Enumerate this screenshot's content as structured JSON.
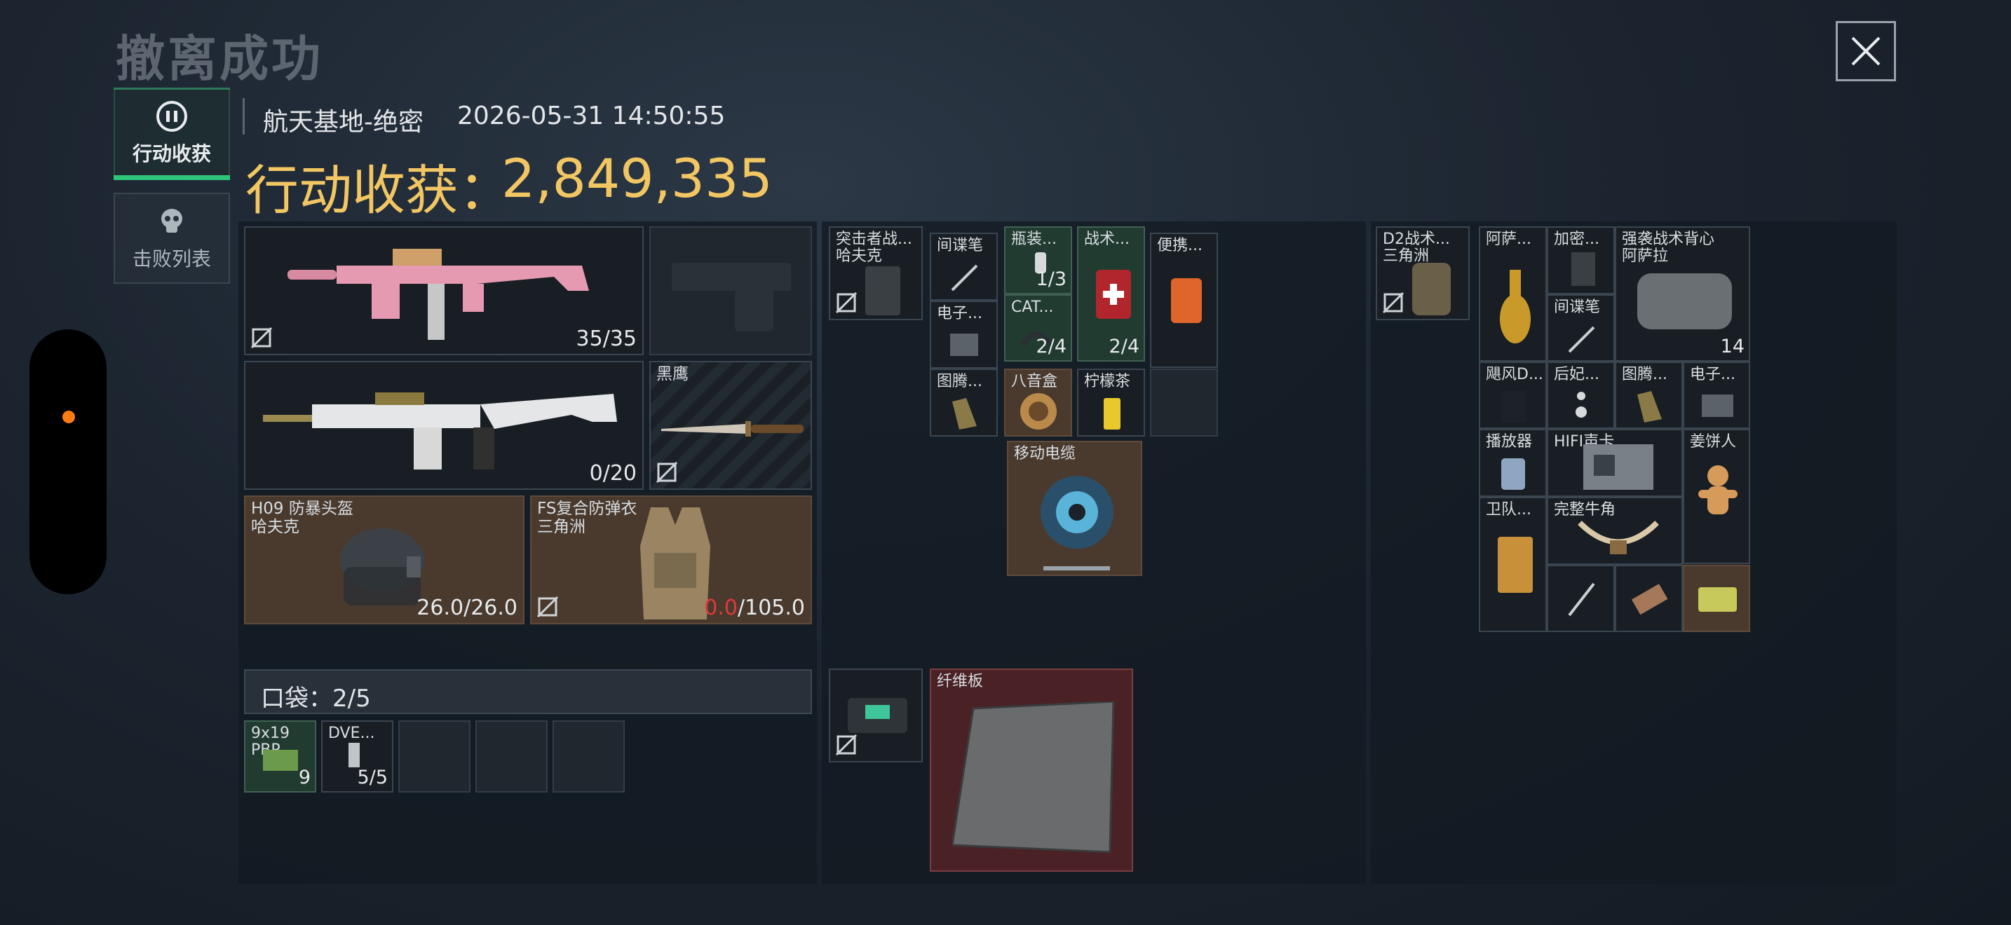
{
  "page": {
    "title": "撤离成功"
  },
  "tabs": [
    {
      "label": "行动收获",
      "icon": "target-icon",
      "active": true
    },
    {
      "label": "击败列表",
      "icon": "skull-icon",
      "active": false
    }
  ],
  "header": {
    "map": "航天基地-绝密",
    "timestamp": "2026-05-31 14:50:55",
    "loot_label": "行动收获：",
    "loot_value": "2,849,335"
  },
  "colors": {
    "accent_gold": "#f2c662",
    "tab_active": "#2ec57a",
    "durability_warning": "#e0393a",
    "recording_dot": "#ff7b14"
  },
  "equipment": {
    "primary_weapon": {
      "ammo": "35/35"
    },
    "pistol_slot": {
      "icon": "pistol-icon"
    },
    "secondary_weapon": {
      "ammo": "0/20"
    },
    "melee": {
      "name": "黑鹰"
    },
    "helmet": {
      "name": "H09 防暴头盔",
      "variant": "哈夫克",
      "durability": "26.0/26.0"
    },
    "armor": {
      "name": "FS复合防弹衣",
      "variant": "三角洲",
      "durability_current": "0.0",
      "durability_max": "/105.0"
    }
  },
  "pocket": {
    "label": "口袋：2/5",
    "items": [
      {
        "name": "9x19",
        "name2": "PBP",
        "count": "9"
      },
      {
        "name": "DVE...",
        "count": "5/5"
      }
    ]
  },
  "chest_rig": {
    "name": "突击者战...",
    "variant": "哈夫克",
    "items": [
      {
        "name": "间谍笔"
      },
      {
        "name": "瓶装...",
        "count": "1/3"
      },
      {
        "name": "战术...",
        "count": "2/4"
      },
      {
        "name": "便携..."
      },
      {
        "name": "电子..."
      },
      {
        "name": "CAT...",
        "count": "2/4"
      },
      {
        "name": "图腾..."
      },
      {
        "name": "八音盒"
      },
      {
        "name": "柠檬茶"
      },
      {
        "name": "移动电缆"
      }
    ]
  },
  "bag_case": {
    "items": [
      {
        "name": "纤维板"
      }
    ]
  },
  "backpack": {
    "name": "D2战术...",
    "variant": "三角洲",
    "items": [
      {
        "name": "阿萨..."
      },
      {
        "name": "加密..."
      },
      {
        "name": "强袭战术背心",
        "variant": "阿萨拉",
        "count": "14"
      },
      {
        "name": "间谍笔"
      },
      {
        "name": "飓风D..."
      },
      {
        "name": "后妃..."
      },
      {
        "name": "图腾..."
      },
      {
        "name": "电子..."
      },
      {
        "name": "播放器"
      },
      {
        "name": "HIFI声卡"
      },
      {
        "name": "姜饼人"
      },
      {
        "name": "卫队..."
      },
      {
        "name": "完整牛角"
      }
    ]
  }
}
